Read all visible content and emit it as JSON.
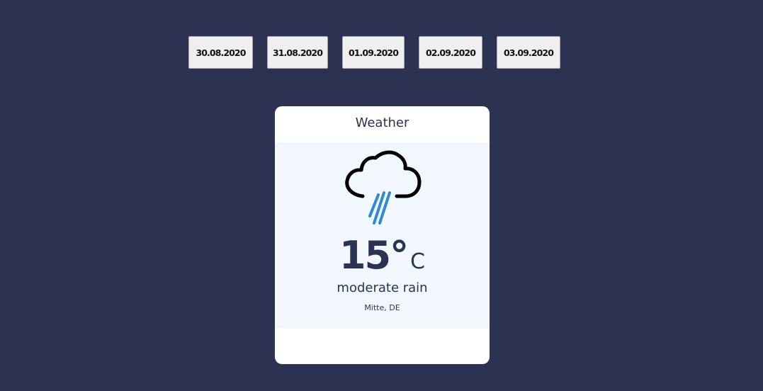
{
  "dates": [
    {
      "label": "30.08.2020"
    },
    {
      "label": "31.08.2020"
    },
    {
      "label": "01.09.2020"
    },
    {
      "label": "02.09.2020"
    },
    {
      "label": "03.09.2020"
    }
  ],
  "card": {
    "title": "Weather",
    "icon": "cloud-rain-icon",
    "temperature": "15°",
    "unit": "C",
    "description": "moderate rain",
    "location": "Mitte, DE"
  },
  "colors": {
    "background": "#2b3252",
    "rain": "#2d8bd4",
    "text": "#2b3252",
    "card_body": "#f2f7fd"
  }
}
